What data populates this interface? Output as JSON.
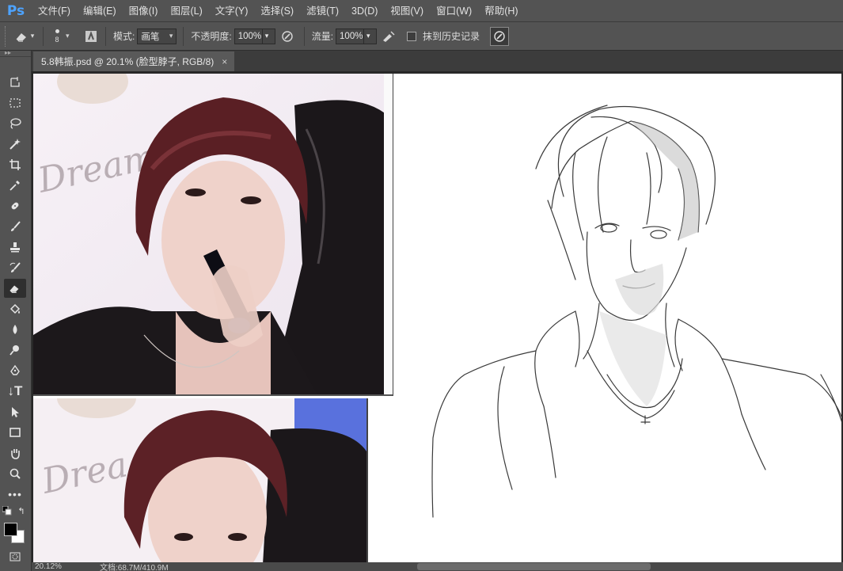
{
  "app": {
    "logo": "Ps"
  },
  "menu": [
    "文件(F)",
    "编辑(E)",
    "图像(I)",
    "图层(L)",
    "文字(Y)",
    "选择(S)",
    "滤镜(T)",
    "3D(D)",
    "视图(V)",
    "窗口(W)",
    "帮助(H)"
  ],
  "options": {
    "brush_size": "8",
    "mode_label": "模式:",
    "mode_value": "画笔",
    "opacity_label": "不透明度:",
    "opacity_value": "100%",
    "flow_label": "流量:",
    "flow_value": "100%",
    "erase_history_label": "抹到历史记录",
    "erase_history_checked": false
  },
  "document": {
    "tab_title": "5.8韩振.psd @ 20.1% (脸型脖子, RGB/8)",
    "close_glyph": "×"
  },
  "status": {
    "zoom": "20.12%",
    "doc_info": "文档:68.7M/410.9M"
  },
  "colors": {
    "foreground": "#000000",
    "background": "#ffffff",
    "logo": "#4da3ff"
  }
}
